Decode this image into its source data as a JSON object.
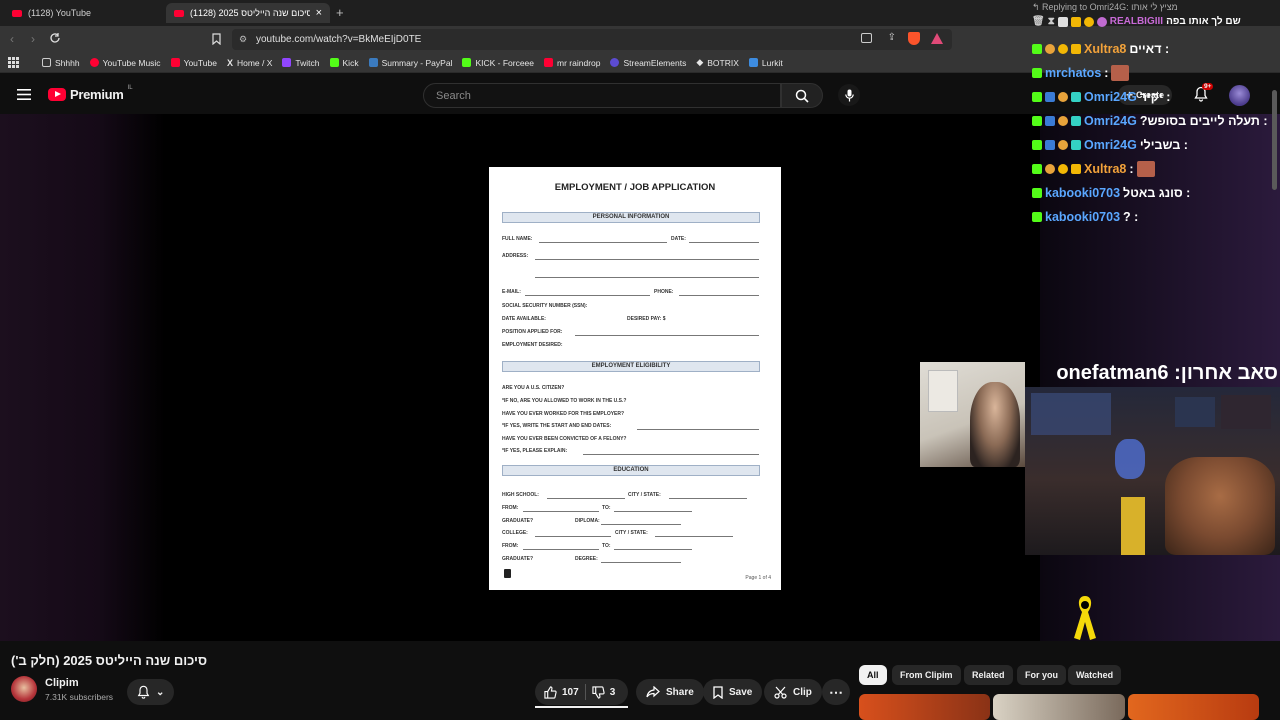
{
  "browser": {
    "tabs": [
      {
        "title": "(1128) YouTube"
      },
      {
        "title": "(1128) סיכום שנה הייליטס 2025"
      }
    ],
    "url": "youtube.com/watch?v=BkMeEIjD0TE",
    "bookmarks": [
      {
        "label": "Shhhh",
        "icon": "folder-icon",
        "color": "#cccccc"
      },
      {
        "label": "YouTube Music",
        "icon": "youtube-music-icon",
        "color": "#ff0033"
      },
      {
        "label": "YouTube",
        "icon": "youtube-icon",
        "color": "#ff0033"
      },
      {
        "label": "Home / X",
        "icon": "x-icon",
        "color": "#ffffff"
      },
      {
        "label": "Twitch",
        "icon": "twitch-icon",
        "color": "#9146ff"
      },
      {
        "label": "Kick",
        "icon": "kick-icon",
        "color": "#53fc18"
      },
      {
        "label": "Summary - PayPal",
        "icon": "paypal-icon",
        "color": "#3b7bbf"
      },
      {
        "label": "KICK - Forceee",
        "icon": "kick-icon",
        "color": "#53fc18"
      },
      {
        "label": "mr raindrop",
        "icon": "youtube-icon",
        "color": "#ff0033"
      },
      {
        "label": "StreamElements",
        "icon": "streamelements-icon",
        "color": "#5c4bd1"
      },
      {
        "label": "BOTRIX",
        "icon": "botrix-icon",
        "color": "#ffffff"
      },
      {
        "label": "Lurkit",
        "icon": "lurkit-icon",
        "color": "#3d8ce0"
      }
    ]
  },
  "youtube": {
    "logo_label": "Premium",
    "region": "IL",
    "search_placeholder": "Search",
    "create_label": "Create",
    "notifications_count": "9+"
  },
  "document": {
    "title": "EMPLOYMENT / JOB APPLICATION",
    "sections": [
      "PERSONAL INFORMATION",
      "EMPLOYMENT ELIGIBILITY",
      "EDUCATION"
    ],
    "personal_rows": [
      "FULL NAME:",
      "ADDRESS:",
      "E-MAIL:",
      "SOCIAL SECURITY NUMBER (SSN):",
      "DATE AVAILABLE:",
      "POSITION APPLIED FOR:",
      "EMPLOYMENT DESIRED:"
    ],
    "personal_right": {
      "date": "DATE:",
      "phone": "PHONE:",
      "pay": "DESIRED PAY: $"
    },
    "eligibility_rows": [
      "ARE YOU A U.S. CITIZEN?",
      "*IF NO, ARE YOU ALLOWED TO WORK IN THE U.S.?",
      "HAVE YOU EVER WORKED FOR THIS EMPLOYER?",
      "*IF YES, WRITE THE START AND END DATES:",
      "HAVE YOU EVER BEEN CONVICTED OF A FELONY?",
      "*IF YES, PLEASE EXPLAIN:"
    ],
    "education_rows": [
      "HIGH SCHOOL:",
      "FROM:",
      "GRADUATE?",
      "COLLEGE:",
      "FROM:",
      "GRADUATE?"
    ],
    "education_right": [
      "CITY / STATE:",
      "TO:",
      "DIPLOMA:",
      "CITY / STATE:",
      "TO:",
      "DEGREE:"
    ],
    "footer": "Page 1 of 4"
  },
  "overlay": {
    "replying_to": "Replying to Omri24G: מציץ לי אותו",
    "top_message": {
      "user": "REALBIGIII",
      "text": "שם לך אותו בפה"
    },
    "messages": [
      {
        "user": "Xultra8",
        "text": ": דאיים",
        "color": "orange"
      },
      {
        "user": "mrchatos",
        "text": ":",
        "color": "blue"
      },
      {
        "user": "Omri24G",
        "text": ": יקיר",
        "color": "blue"
      },
      {
        "user": "Omri24G",
        "text": ": תעלה לייבים בסופש?",
        "color": "blue"
      },
      {
        "user": "Omri24G",
        "text": ": בשבילי",
        "color": "blue"
      },
      {
        "user": "Xultra8",
        "text": ":",
        "color": "orange"
      },
      {
        "user": "kabooki0703",
        "text": ": סונג באטל",
        "color": "blue"
      },
      {
        "user": "kabooki0703",
        "text": ": ?",
        "color": "blue"
      }
    ],
    "last_sub": "onefatman6 :סאב אחרון"
  },
  "video_info": {
    "title": "סיכום שנה הייליטס 2025 (חלק ב')",
    "channel": "Clipim",
    "subscribers": "7.31K subscribers",
    "likes": "107",
    "dislikes": "3",
    "share_label": "Share",
    "save_label": "Save",
    "clip_label": "Clip"
  },
  "chips": [
    "All",
    "From Clipim",
    "Related",
    "For you",
    "Watched"
  ]
}
